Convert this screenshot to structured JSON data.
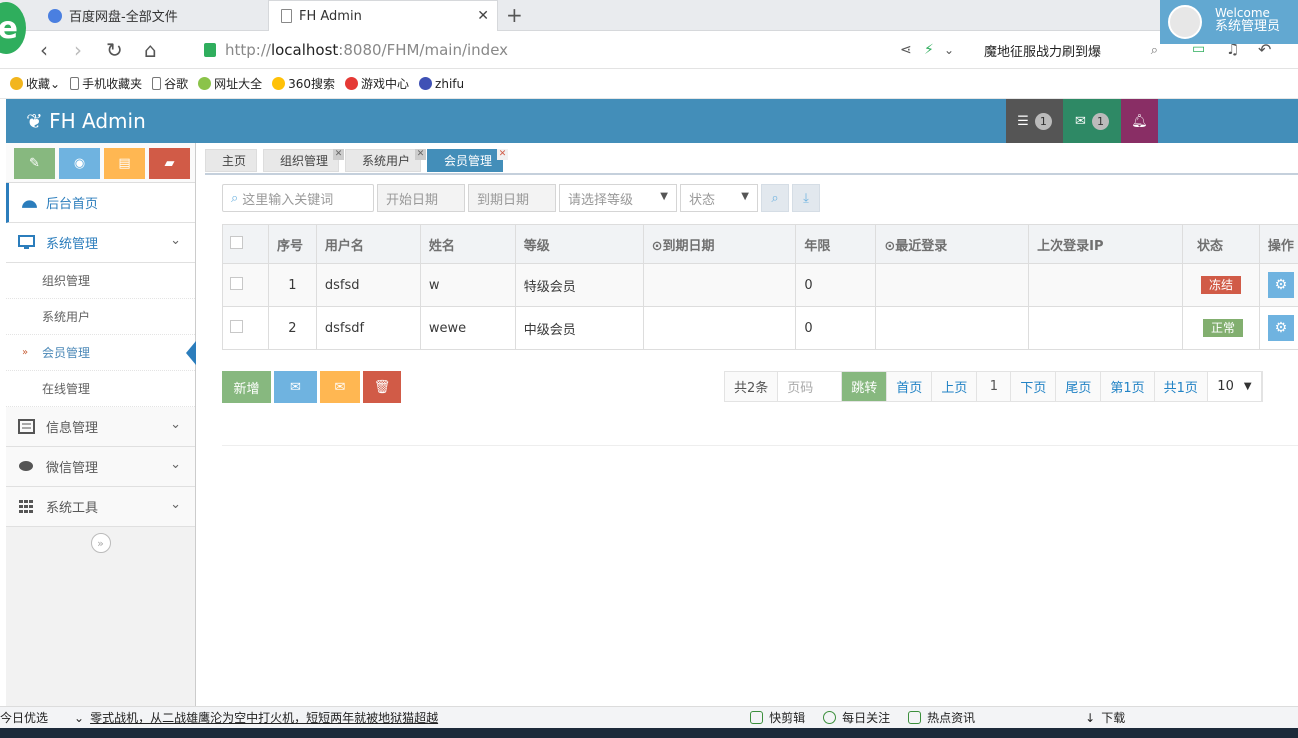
{
  "browser": {
    "tabs": [
      {
        "label": "百度网盘-全部文件"
      },
      {
        "label": "FH Admin"
      }
    ],
    "url_host": "localhost",
    "url_rest": ":8080/FHM/main/index",
    "url_scheme": "http://",
    "search_text": "魔地征服战力刷到爆",
    "bookmarks": [
      "收藏",
      "手机收藏夹",
      "谷歌",
      "网址大全",
      "360搜索",
      "游戏中心",
      "zhifu"
    ]
  },
  "header": {
    "brand": "FH Admin",
    "tasks_count": "1",
    "messages_count": "1",
    "welcome": "Welcome",
    "username": "系统管理员"
  },
  "sidebar": {
    "menus": [
      {
        "label": "后台首页",
        "icon": "dashboard-icon"
      },
      {
        "label": "系统管理",
        "icon": "desktop-icon"
      },
      {
        "label": "信息管理",
        "icon": "list-icon"
      },
      {
        "label": "微信管理",
        "icon": "comments-icon"
      },
      {
        "label": "系统工具",
        "icon": "grid-icon"
      }
    ],
    "subitems": [
      {
        "label": "组织管理"
      },
      {
        "label": "系统用户"
      },
      {
        "label": "会员管理"
      },
      {
        "label": "在线管理"
      }
    ]
  },
  "page_tabs": [
    {
      "label": "主页"
    },
    {
      "label": "组织管理"
    },
    {
      "label": "系统用户"
    },
    {
      "label": "会员管理"
    }
  ],
  "filters": {
    "keyword_placeholder": "这里输入关键词",
    "start_date": "开始日期",
    "end_date": "到期日期",
    "level": "请选择等级",
    "status": "状态"
  },
  "table": {
    "headers": [
      "序号",
      "用户名",
      "姓名",
      "等级",
      "到期日期",
      "年限",
      "最近登录",
      "上次登录IP",
      "状态",
      "操作"
    ],
    "rows": [
      {
        "no": "1",
        "username": "dsfsd",
        "name": "w",
        "level": "特级会员",
        "expire": "",
        "years": "0",
        "last_login": "",
        "ip": "",
        "status": "冻结"
      },
      {
        "no": "2",
        "username": "dsfsdf",
        "name": "wewe",
        "level": "中级会员",
        "expire": "",
        "years": "0",
        "last_login": "",
        "ip": "",
        "status": "正常"
      }
    ]
  },
  "actions": {
    "add": "新增"
  },
  "pager": {
    "total": "共2条",
    "page_input": "页码",
    "go": "跳转",
    "first": "首页",
    "prev": "上页",
    "current": "1",
    "next": "下页",
    "last": "尾页",
    "page_of": "第1页",
    "total_pages": "共1页",
    "size": "10"
  },
  "statusbar": {
    "left": "今日优选",
    "news": "零式战机，从二战雄鹰沦为空中打火机，短短两年就被地狱猫超越",
    "items": [
      "快剪辑",
      "每日关注",
      "热点资讯",
      "下载"
    ]
  },
  "colors": {
    "accent": "#438eb9",
    "success": "#87b87f",
    "danger": "#d15b47"
  }
}
